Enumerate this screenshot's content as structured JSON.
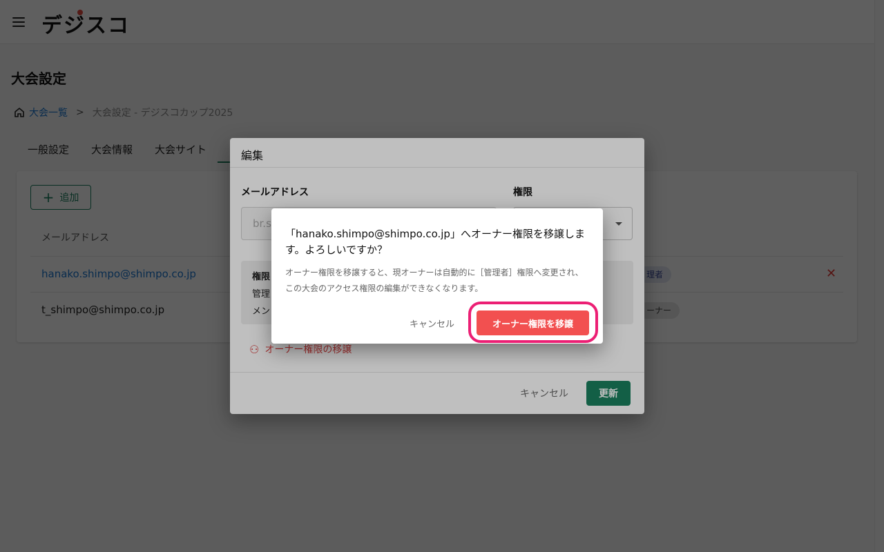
{
  "app": {
    "logo": "デジスコ"
  },
  "page": {
    "title": "大会設定"
  },
  "breadcrumb": {
    "home": "大会一覧",
    "separator": ">",
    "current": "大会設定 - デジスコカップ2025"
  },
  "tabs": [
    {
      "label": "一般設定"
    },
    {
      "label": "大会情報"
    },
    {
      "label": "大会サイト"
    },
    {
      "label": ""
    }
  ],
  "members": {
    "add_label": "追加",
    "column_email": "メールアドレス",
    "rows": [
      {
        "email": "hanako.shimpo@shimpo.co.jp",
        "role": "理者"
      },
      {
        "email": "t_shimpo@shimpo.co.jp",
        "role": "ーナー"
      }
    ]
  },
  "edit_dialog": {
    "title": "編集",
    "email_label": "メールアドレス",
    "role_label": "権限",
    "email_value": "br.si",
    "info_title": "権限",
    "info_line1": "管理",
    "info_line2": "メン",
    "transfer_link": "オーナー権限の移譲",
    "cancel": "キャンセル",
    "update": "更新"
  },
  "confirm_dialog": {
    "title": "「hanako.shimpo@shimpo.co.jp」へオーナー権限を移譲します。よろしいですか？",
    "body": "オーナー権限を移譲すると、現オーナーは自動的に［管理者］権限へ変更され、この大会のアクセス権限の編集ができなくなります。",
    "cancel": "キャンセル",
    "confirm": "オーナー権限を移譲"
  },
  "colors": {
    "primary": "#1a7f5e",
    "danger": "#f25050",
    "highlight": "#ec1f74",
    "link": "#1976d2"
  }
}
